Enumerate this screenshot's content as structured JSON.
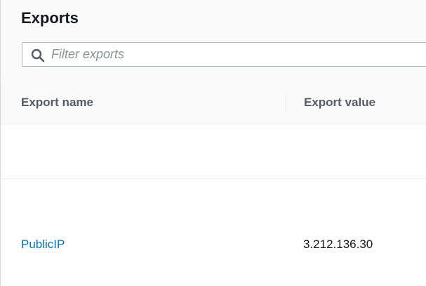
{
  "panel": {
    "title": "Exports"
  },
  "search": {
    "placeholder": "Filter exports",
    "value": ""
  },
  "table": {
    "columns": [
      {
        "label": "Export name"
      },
      {
        "label": "Export value"
      }
    ],
    "rows": [
      {
        "name": "PublicIP",
        "value": "3.212.136.30"
      }
    ]
  },
  "colors": {
    "link": "#0073bb",
    "header_bg": "#fafafa",
    "text": "#16191f",
    "muted": "#545b64"
  },
  "icons": {
    "search": "search-icon"
  }
}
